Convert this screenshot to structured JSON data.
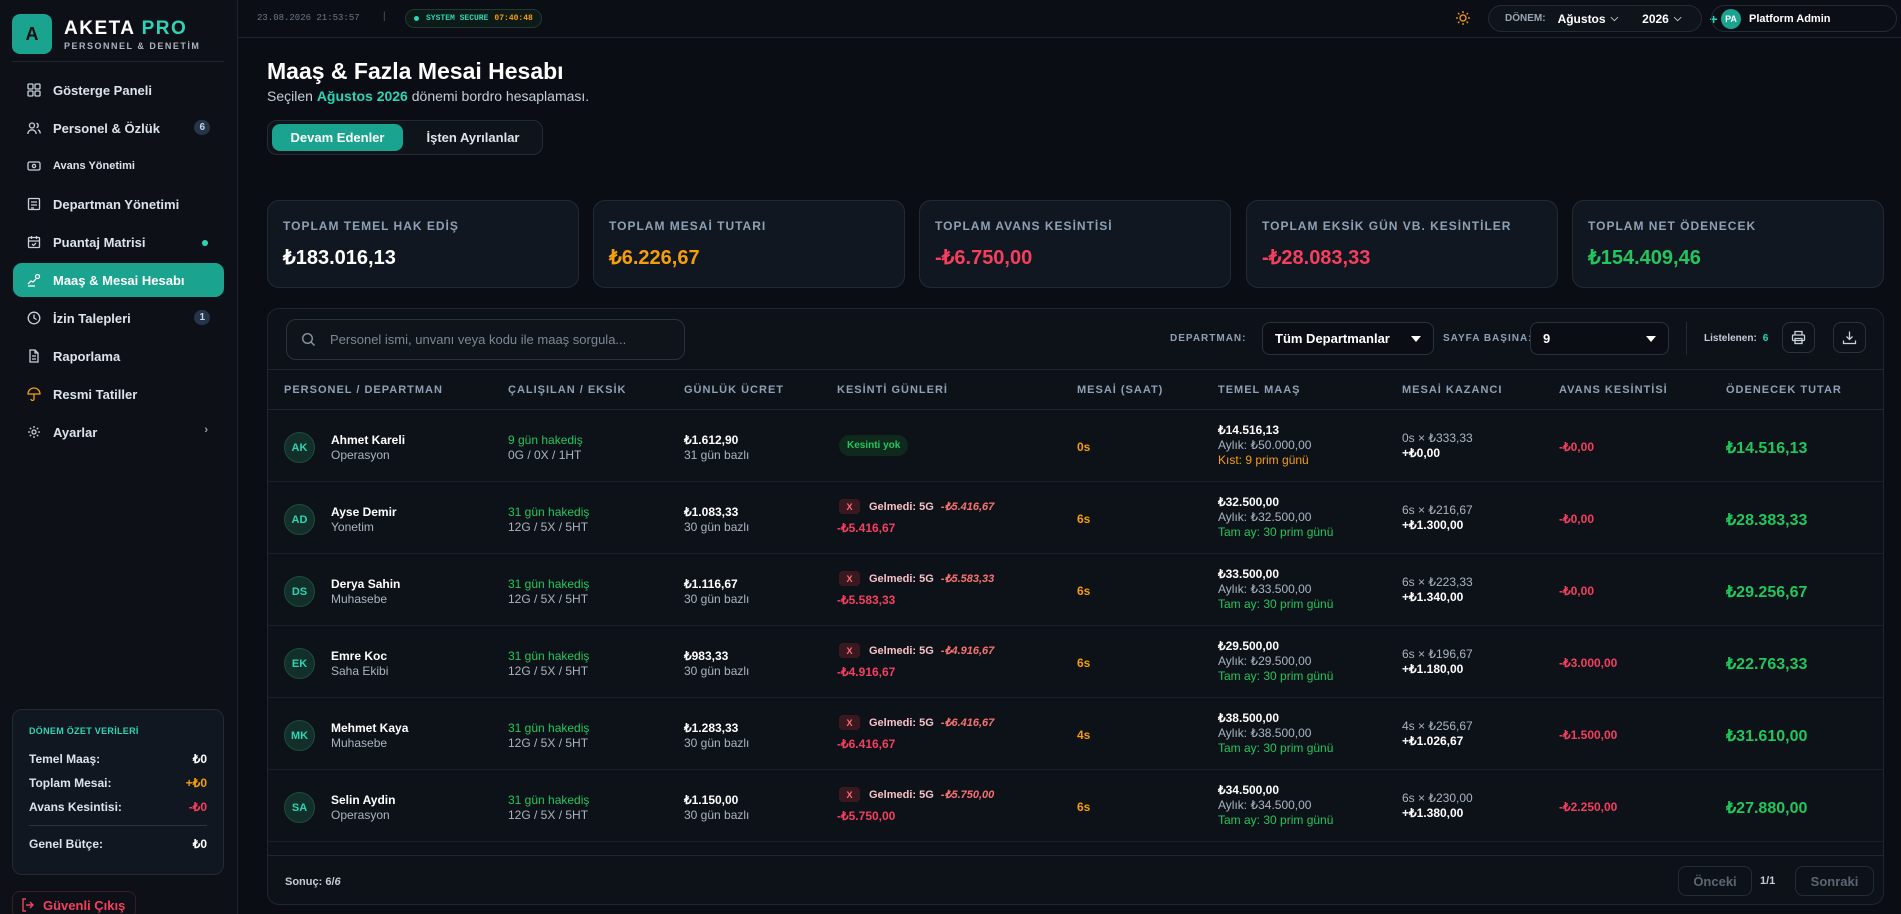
{
  "brand": {
    "name": "AKETA",
    "accent": "PRO",
    "subtitle": "PERSONNEL & DENETİM",
    "logo_letter": "A"
  },
  "nav": [
    {
      "label": "Gösterge Paneli",
      "icon": "grid-icon"
    },
    {
      "label": "Personel & Özlük",
      "icon": "users-icon",
      "badge": "6"
    },
    {
      "label": "Avans Yönetimi",
      "icon": "wallet-icon"
    },
    {
      "label": "Departman Yönetimi",
      "icon": "building-icon"
    },
    {
      "label": "Puantaj Matrisi",
      "icon": "calendar-icon"
    },
    {
      "label": "Maaş & Mesai Hesabı",
      "icon": "hand-coins-icon"
    },
    {
      "label": "İzin Talepleri",
      "icon": "clock-icon",
      "badge": "1"
    },
    {
      "label": "Raporlama",
      "icon": "file-icon"
    },
    {
      "label": "Resmi Tatiller",
      "icon": "umbrella-icon"
    },
    {
      "label": "Ayarlar",
      "icon": "gear-icon",
      "chevron": "›"
    }
  ],
  "summary": {
    "title": "DÖNEM ÖZET VERİLERİ",
    "rows": [
      {
        "label": "Temel Maaş:",
        "value": "₺0"
      },
      {
        "label": "Toplam Mesai:",
        "value": "+₺0"
      },
      {
        "label": "Avans Kesintisi:",
        "value": "-₺0"
      }
    ],
    "total_label": "Genel Bütçe:",
    "total_value": "₺0"
  },
  "logout": "Güvenli Çıkış",
  "topbar": {
    "datetime": "23.08.2026 21:53:57",
    "separator": "|",
    "secure_label": "SYSTEM SECURE",
    "secure_time": "07:40:48",
    "period_label": "DÖNEM:",
    "month": "Ağustos",
    "year": "2026",
    "plus": "+",
    "user_initials": "PA",
    "user_name": "Platform Admin"
  },
  "page": {
    "title": "Maaş & Fazla Mesai Hesabı",
    "subtitle_pre": "Seçilen",
    "subtitle_hl": "Ağustos 2026",
    "subtitle_post": "dönemi bordro hesaplaması.",
    "tab_active": "Devam Edenler",
    "tab_inactive": "İşten Ayrılanlar"
  },
  "cards": [
    {
      "title": "TOPLAM TEMEL HAK EDİŞ",
      "value": "₺183.016,13",
      "color": "white"
    },
    {
      "title": "TOPLAM MESAİ TUTARI",
      "value": "₺6.226,67",
      "color": "orange"
    },
    {
      "title": "TOPLAM AVANS KESİNTİSİ",
      "value": "-₺6.750,00",
      "color": "red"
    },
    {
      "title": "TOPLAM EKSİK GÜN VB. KESİNTİLER",
      "value": "-₺28.083,33",
      "color": "red"
    },
    {
      "title": "TOPLAM NET ÖDENECEK",
      "value": "₺154.409,46",
      "color": "green"
    }
  ],
  "filters": {
    "search_placeholder": "Personel ismi, unvanı veya kodu ile maaş sorgula...",
    "dept_label": "DEPARTMAN:",
    "dept_value": "Tüm Departmanlar",
    "page_size_label": "SAYFA BAŞINA:",
    "page_size_value": "9",
    "listed_label": "Listelenen:",
    "listed_count": "6"
  },
  "table": {
    "headers": [
      "PERSONEL / DEPARTMAN",
      "ÇALIŞILAN / EKSİK",
      "GÜNLÜK ÜCRET",
      "KESİNTİ GÜNLERİ",
      "MESAİ (SAAT)",
      "TEMEL MAAŞ",
      "MESAİ KAZANCI",
      "AVANS KESİNTİSİ",
      "ÖDENECEK TUTAR"
    ],
    "rows": [
      {
        "initials": "AK",
        "name": "Ahmet Kareli",
        "dept": "Operasyon",
        "worked": "9 gün hakediş",
        "worked_detail": "0G / 0X / 1HT",
        "daily": "₺1.612,90",
        "daily_basis": "31 gün bazlı",
        "cut_none": "Kesinti yok",
        "overtime": "0s",
        "base": "₺14.516,13",
        "monthly": "Aylık: ₺50.000,00",
        "prim": "Kıst: 9 prim günü",
        "prim_color": "orange",
        "ot_calc": "0s × ₺333,33",
        "ot_total": "+₺0,00",
        "advance": "-₺0,00",
        "net": "₺14.516,13"
      },
      {
        "initials": "AD",
        "name": "Ayse Demir",
        "dept": "Yonetim",
        "worked": "31 gün hakediş",
        "worked_detail": "12G / 5X / 5HT",
        "daily": "₺1.083,33",
        "daily_basis": "30 gün bazlı",
        "cut_x": "X",
        "cut_label": "Gelmedi: 5G",
        "cut_amount": "-₺5.416,67",
        "cut_total": "-₺5.416,67",
        "overtime": "6s",
        "base": "₺32.500,00",
        "monthly": "Aylık: ₺32.500,00",
        "prim": "Tam ay: 30 prim günü",
        "ot_calc": "6s × ₺216,67",
        "ot_total": "+₺1.300,00",
        "advance": "-₺0,00",
        "net": "₺28.383,33"
      },
      {
        "initials": "DS",
        "name": "Derya Sahin",
        "dept": "Muhasebe",
        "worked": "31 gün hakediş",
        "worked_detail": "12G / 5X / 5HT",
        "daily": "₺1.116,67",
        "daily_basis": "30 gün bazlı",
        "cut_x": "X",
        "cut_label": "Gelmedi: 5G",
        "cut_amount": "-₺5.583,33",
        "cut_total": "-₺5.583,33",
        "overtime": "6s",
        "base": "₺33.500,00",
        "monthly": "Aylık: ₺33.500,00",
        "prim": "Tam ay: 30 prim günü",
        "ot_calc": "6s × ₺223,33",
        "ot_total": "+₺1.340,00",
        "advance": "-₺0,00",
        "net": "₺29.256,67"
      },
      {
        "initials": "EK",
        "name": "Emre Koc",
        "dept": "Saha Ekibi",
        "worked": "31 gün hakediş",
        "worked_detail": "12G / 5X / 5HT",
        "daily": "₺983,33",
        "daily_basis": "30 gün bazlı",
        "cut_x": "X",
        "cut_label": "Gelmedi: 5G",
        "cut_amount": "-₺4.916,67",
        "cut_total": "-₺4.916,67",
        "overtime": "6s",
        "base": "₺29.500,00",
        "monthly": "Aylık: ₺29.500,00",
        "prim": "Tam ay: 30 prim günü",
        "ot_calc": "6s × ₺196,67",
        "ot_total": "+₺1.180,00",
        "advance": "-₺3.000,00",
        "net": "₺22.763,33"
      },
      {
        "initials": "MK",
        "name": "Mehmet Kaya",
        "dept": "Muhasebe",
        "worked": "31 gün hakediş",
        "worked_detail": "12G / 5X / 5HT",
        "daily": "₺1.283,33",
        "daily_basis": "30 gün bazlı",
        "cut_x": "X",
        "cut_label": "Gelmedi: 5G",
        "cut_amount": "-₺6.416,67",
        "cut_total": "-₺6.416,67",
        "overtime": "4s",
        "base": "₺38.500,00",
        "monthly": "Aylık: ₺38.500,00",
        "prim": "Tam ay: 30 prim günü",
        "ot_calc": "4s × ₺256,67",
        "ot_total": "+₺1.026,67",
        "advance": "-₺1.500,00",
        "net": "₺31.610,00"
      },
      {
        "initials": "SA",
        "name": "Selin Aydin",
        "dept": "Operasyon",
        "worked": "31 gün hakediş",
        "worked_detail": "12G / 5X / 5HT",
        "daily": "₺1.150,00",
        "daily_basis": "30 gün bazlı",
        "cut_x": "X",
        "cut_label": "Gelmedi: 5G",
        "cut_amount": "-₺5.750,00",
        "cut_total": "-₺5.750,00",
        "overtime": "6s",
        "base": "₺34.500,00",
        "monthly": "Aylık: ₺34.500,00",
        "prim": "Tam ay: 30 prim günü",
        "ot_calc": "6s × ₺230,00",
        "ot_total": "+₺1.380,00",
        "advance": "-₺2.250,00",
        "net": "₺27.880,00"
      }
    ]
  },
  "footer": {
    "result_label": "Sonuç:",
    "result_shown": "6",
    "result_total": "6",
    "prev": "Önceki",
    "page_info": "1/1",
    "next": "Sonraki"
  }
}
